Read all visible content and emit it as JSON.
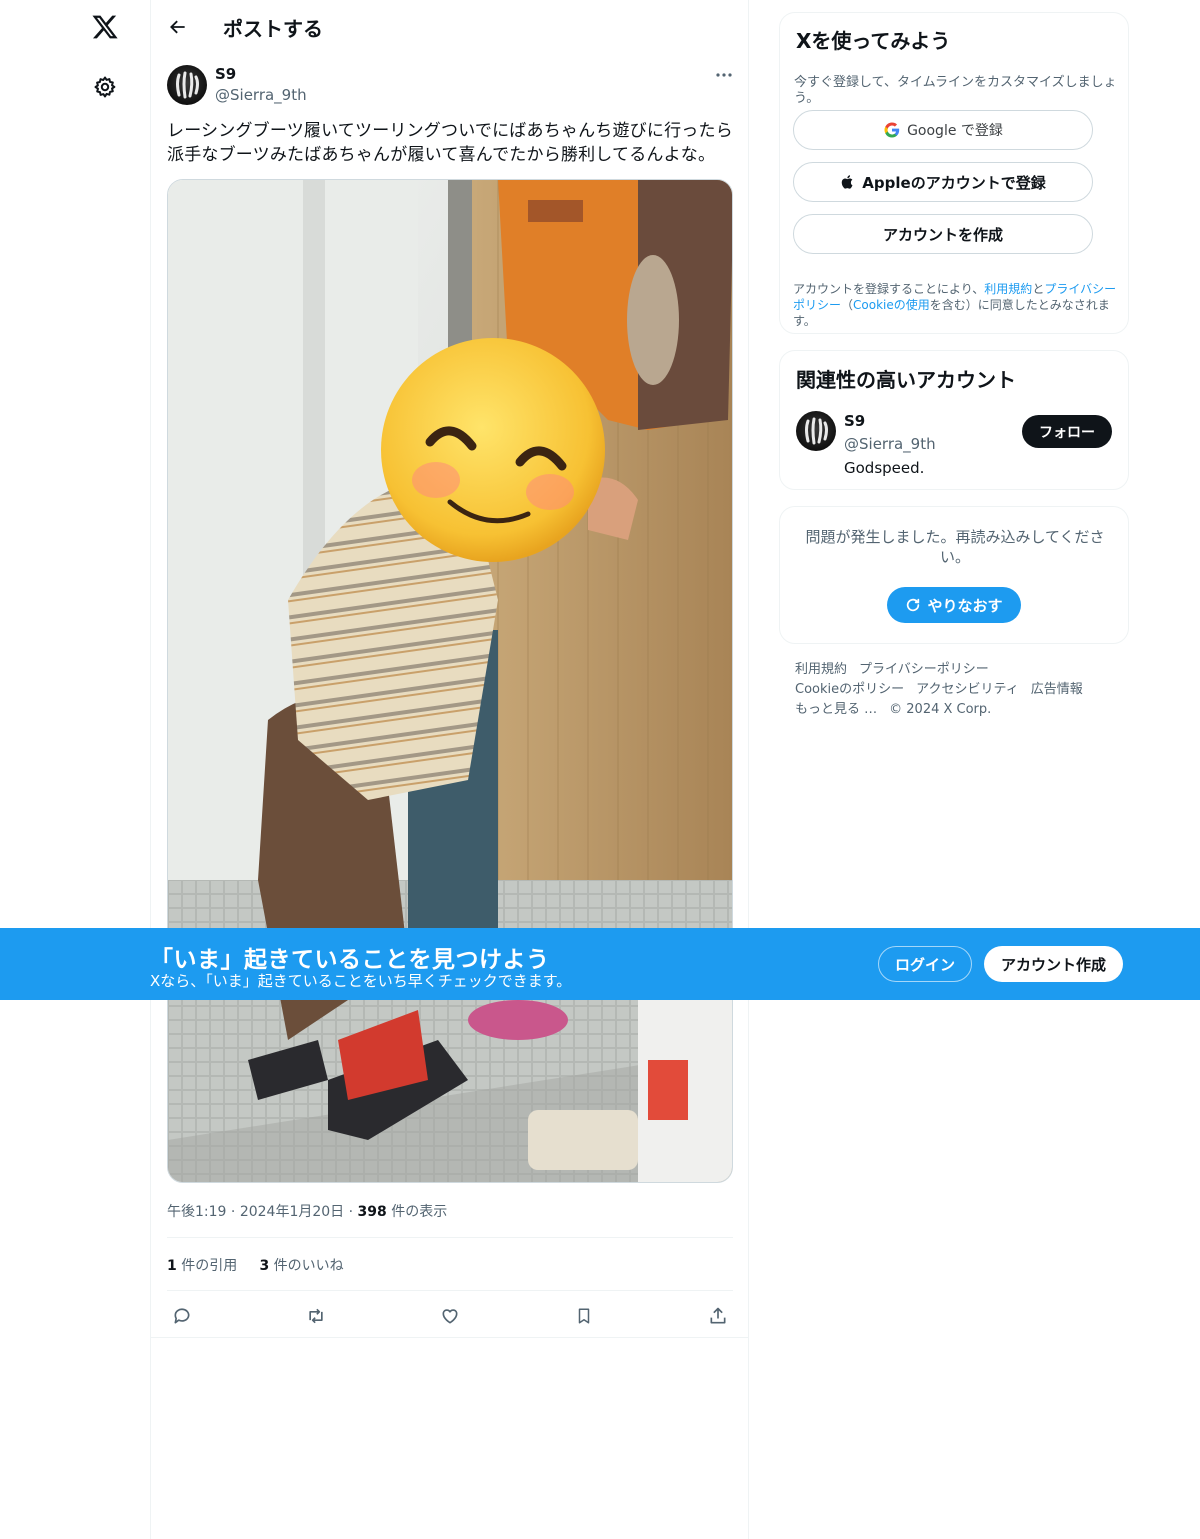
{
  "nav": {
    "logo_icon": "x-logo-icon",
    "settings_icon": "gear-icon"
  },
  "header": {
    "title": "ポストする",
    "back_icon": "arrow-left-icon"
  },
  "post": {
    "author_name": "S9",
    "author_handle": "@Sierra_9th",
    "text": "レーシングブーツ履いてツーリングついでにばあちゃんち遊びに行ったら派手なブーツみたばあちゃんが履いて喜んでたから勝利してるんよな。",
    "time": "午後1:19",
    "date": "2024年1月20日",
    "views_count": "398",
    "views_label": "件の表示",
    "quotes_count": "1",
    "quotes_label": "件の引用",
    "likes_count": "3",
    "likes_label": "件のいいね",
    "actions": [
      "reply-icon",
      "repost-icon",
      "like-icon",
      "bookmark-icon",
      "share-icon"
    ]
  },
  "signup_card": {
    "title": "Xを使ってみよう",
    "subtitle": "今すぐ登録して、タイムラインをカスタマイズしましょう。",
    "google_label": "Google で登録",
    "apple_label": "Appleのアカウントで登録",
    "create_label": "アカウントを作成",
    "legal_prefix": "アカウントを登録することにより、",
    "legal_terms": "利用規約",
    "legal_and": "と",
    "legal_privacy": "プライバシーポリシー",
    "legal_mid": "（",
    "legal_cookie": "Cookieの使用",
    "legal_suffix": "を含む）に同意したとみなされます。"
  },
  "relevant_card": {
    "title": "関連性の高いアカウント",
    "name": "S9",
    "handle": "@Sierra_9th",
    "bio": "Godspeed.",
    "follow_label": "フォロー"
  },
  "error_card": {
    "message": "問題が発生しました。再読み込みしてください。",
    "retry_label": "やりなおす"
  },
  "footer": {
    "links": [
      "利用規約",
      "プライバシーポリシー",
      "Cookieのポリシー",
      "アクセシビリティ",
      "広告情報",
      "もっと見る …",
      "© 2024 X Corp."
    ]
  },
  "banner": {
    "title": "「いま」起きていることを見つけよう",
    "subtitle": "Xなら、「いま」起きていることをいち早くチェックできます。",
    "login_label": "ログイン",
    "signup_label": "アカウント作成"
  },
  "colors": {
    "accent": "#1d9bf0",
    "text": "#0f1419",
    "muted": "#536471",
    "border": "#eff3f4"
  }
}
